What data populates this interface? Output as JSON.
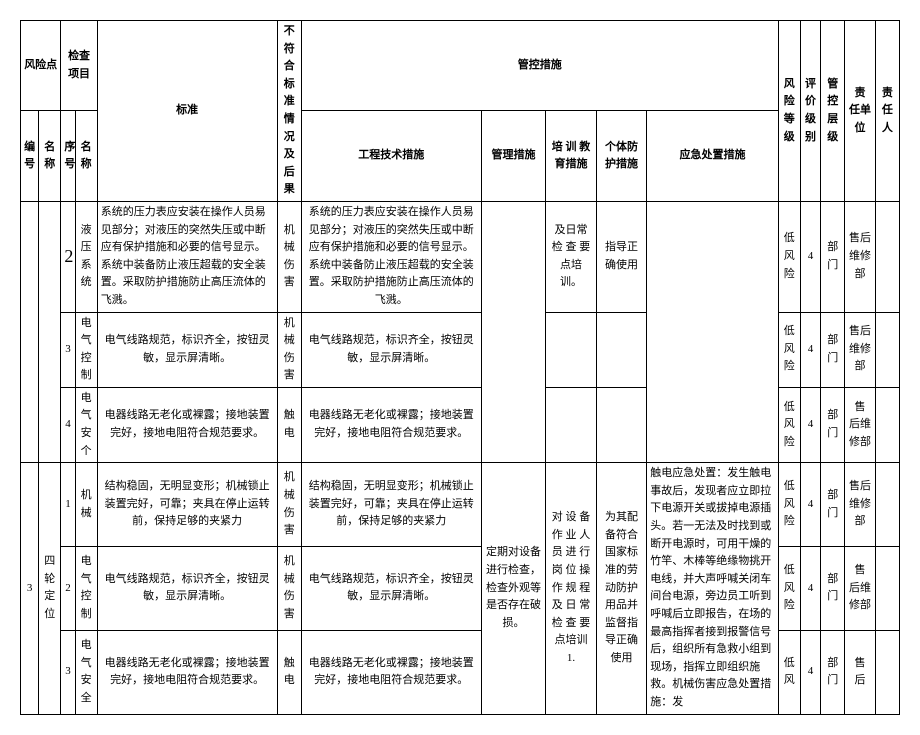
{
  "headers": {
    "risk_point": "风险点",
    "check_item": "检查项目",
    "standard": "标准",
    "nonconform": "不符合标准情况及后果",
    "control_measures": "管控措施",
    "eng_tech": "工程技术措施",
    "mgmt": "管理措施",
    "training": "培 训 教育措施",
    "ppe": "个体防护措施",
    "emergency": "应急处置措施",
    "risk_level": "风险等级",
    "eval_level": "评价级别",
    "ctrl_level": "管 控层级",
    "resp_unit": "责 任单位",
    "resp_person": "责 任人",
    "no": "编号",
    "name": "名称",
    "seq": "序号"
  },
  "rows": {
    "r1": {
      "seq": "2",
      "item": "液 压系统",
      "standard": "系统的压力表应安装在操作人员易见部分；对液压的突然失压或中断应有保护措施和必要的信号显示。系统中装备防止液压超载的安全装置。采取防护措施防止高压流体的飞溅。",
      "nonconform": "机械伤害",
      "eng": "系统的压力表应安装在操作人员易见部分；对液压的突然失压或中断应有保护措施和必要的信号显示。系统中装备防止液压超载的安全装置。采取防护措施防止高压流体的飞溅。",
      "training": "及日常检 查 要点培训。",
      "ppe": "指导正确使用",
      "risk": "低风险",
      "eval": "4",
      "ctrl": "部 门",
      "unit": "售后 维修部"
    },
    "r2": {
      "seq": "3",
      "item": "电气控制",
      "standard": "电气线路规范，标识齐全，按钮灵敏，显示屏清晰。",
      "nonconform": "机械伤害",
      "eng": "电气线路规范，标识齐全，按钮灵敏，显示屏清晰。",
      "risk": "低风险",
      "eval": "4",
      "ctrl": "部门",
      "unit": "售后维修部"
    },
    "r3": {
      "seq": "4",
      "item": "电气安个",
      "standard": "电器线路无老化或裸露；接地装置完好，接地电阻符合规范要求。",
      "nonconform": "触电",
      "eng": "电器线路无老化或裸露；接地装置完好，接地电阻符合规范要求。",
      "risk": "低风险",
      "eval": "4",
      "ctrl": "部门",
      "unit": "售 后维修部"
    },
    "group2": {
      "no": "3",
      "name": "四轮定位",
      "mgmt": "定期对设备进行检查，检查外观等是否存在破损。",
      "training": "对 设 备作 业 人员 进 行岗 位 操作 规 程及 日 常检 查 要点培训 1.",
      "ppe": "为其配备符合国家标准的劳动防护用品并监督指导正确使用",
      "emergency": "触电应急处置：发生触电事故后，发现者应立即拉下电源开关或拔掉电源插头。若一无法及时找到或断开电源时，可用干燥的竹竿、木棒等绝缘物挑开电线，并大声呼喊关闭车间台电源，旁边员工听到呼喊后立即报告，在场的最高指挥者接到报警信号后，组织所有急救小组到现场，指挥立即组织施救。机械伤害应急处置措施：发"
    },
    "r4": {
      "seq": "1",
      "item": "机械",
      "standard": "结构稳固，无明显变形；机械锁止装置完好，可靠；夹具在停止运转前，保持足够的夹紧力",
      "nonconform": "机械伤害",
      "eng": "结构稳固，无明显变形；机械锁止装置完好，可靠；夹具在停止运转前，保持足够的夹紧力",
      "risk": "低风险",
      "eval": "4",
      "ctrl": "部 门",
      "unit": "售后 维修部"
    },
    "r5": {
      "seq": "2",
      "item": "电气控制",
      "standard": "电气线路规范，标识齐全，按钮灵敏，显示屏清晰。",
      "nonconform": "机械伤害",
      "eng": "电气线路规范，标识齐全，按钮灵敏，显示屏清晰。",
      "risk": "低风险",
      "eval": "4",
      "ctrl": "部门",
      "unit": "售 后维修部"
    },
    "r6": {
      "seq": "3",
      "item": "电气安全",
      "standard": "电器线路无老化或裸露；接地装置完好，接地电阻符合规范要求。",
      "nonconform": "触电",
      "eng": "电器线路无老化或裸露；接地装置完好，接地电阻符合规范要求。",
      "risk": "低风",
      "eval": "4",
      "ctrl": "部门",
      "unit": "售 后"
    }
  }
}
